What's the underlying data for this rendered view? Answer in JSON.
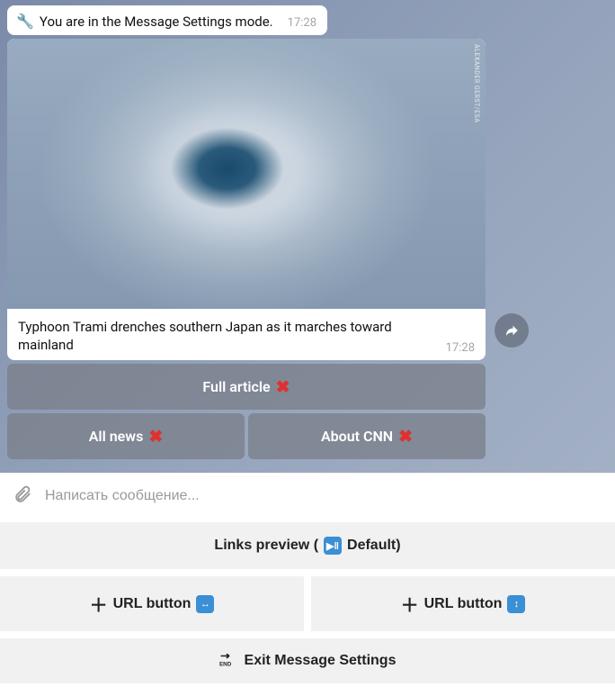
{
  "top_message": {
    "text": "You are in the Message Settings mode.",
    "time": "17:28"
  },
  "card": {
    "image_credit": "ALEXANDER GERST/ESA",
    "caption": "Typhoon Trami drenches southern Japan as it marches toward mainland",
    "time": "17:28"
  },
  "inline_buttons": {
    "row1": [
      {
        "label": "Full article"
      }
    ],
    "row2": [
      {
        "label": "All news"
      },
      {
        "label": "About CNN"
      }
    ]
  },
  "composer": {
    "placeholder": "Написать сообщение..."
  },
  "panel": {
    "links_preview_prefix": "Links preview (",
    "links_preview_suffix": " Default)",
    "url_button_left": "URL button",
    "url_button_right": "URL button",
    "exit": "Exit Message Settings"
  }
}
